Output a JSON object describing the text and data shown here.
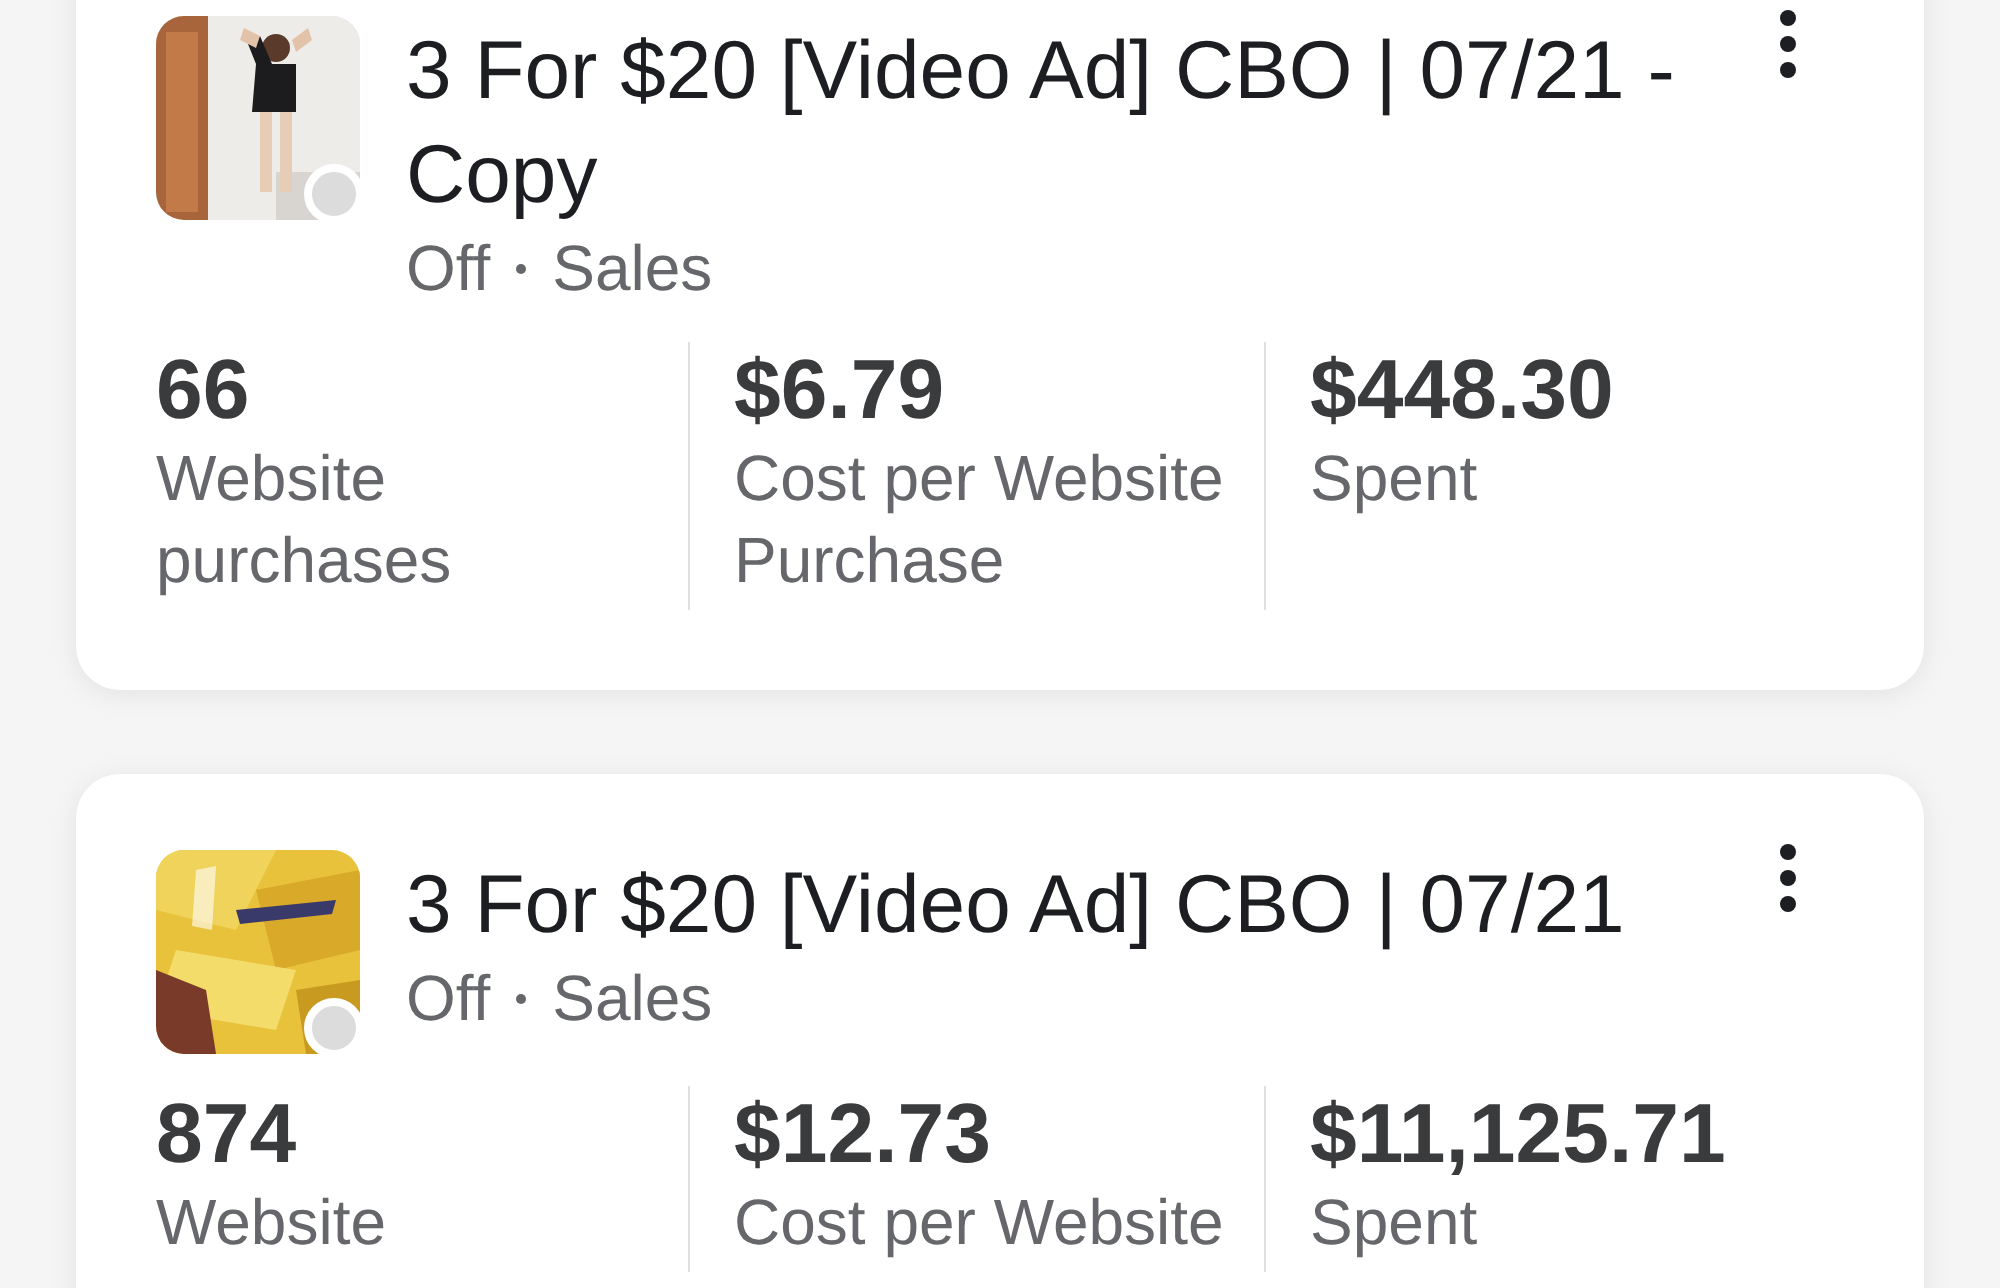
{
  "ads": [
    {
      "title": "3 For $20 [Video Ad] CBO | 07/21 - Copy",
      "active": false,
      "status": "Off",
      "objective": "Sales",
      "kind": "picture",
      "metrics": [
        {
          "value": "66",
          "label": "Website purchases"
        },
        {
          "value": "$6.79",
          "label": "Cost per Website Purchase"
        },
        {
          "value": "$448.30",
          "label": "Spent"
        }
      ]
    },
    {
      "title": "3 For $20 [Video Ad] CBO | 07/21",
      "active": false,
      "status": "Off",
      "objective": "Sales",
      "kind": "picture",
      "metrics": [
        {
          "value": "874",
          "label": "Website"
        },
        {
          "value": "$12.73",
          "label": "Cost per Website"
        },
        {
          "value": "$11,125.71",
          "label": "Spent"
        }
      ]
    }
  ]
}
